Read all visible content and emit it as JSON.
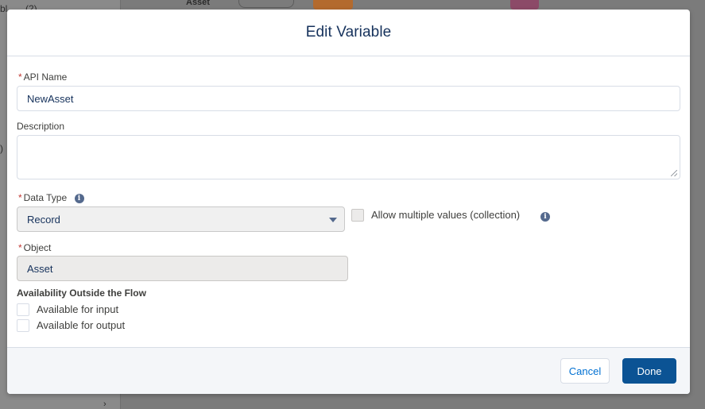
{
  "background": {
    "left_fragments": [
      "bl",
      "(2)",
      ")"
    ],
    "node_label": "Asset"
  },
  "modal": {
    "title": "Edit Variable",
    "api_name": {
      "label": "API Name",
      "required_mark": "*",
      "value": "NewAsset"
    },
    "description": {
      "label": "Description",
      "value": ""
    },
    "data_type": {
      "label": "Data Type",
      "required_mark": "*",
      "selected": "Record",
      "info_icon": "info-icon"
    },
    "collection": {
      "label": "Allow multiple values (collection)",
      "checked": false
    },
    "object": {
      "label": "Object",
      "required_mark": "*",
      "value": "Asset"
    },
    "availability": {
      "title": "Availability Outside the Flow",
      "input_label": "Available for input",
      "output_label": "Available for output",
      "input_checked": false,
      "output_checked": false
    },
    "footer": {
      "cancel_label": "Cancel",
      "done_label": "Done"
    }
  },
  "colors": {
    "brand_button": "#0b5394",
    "required": "#c23934",
    "text": "#16325c",
    "link": "#0070d2"
  }
}
